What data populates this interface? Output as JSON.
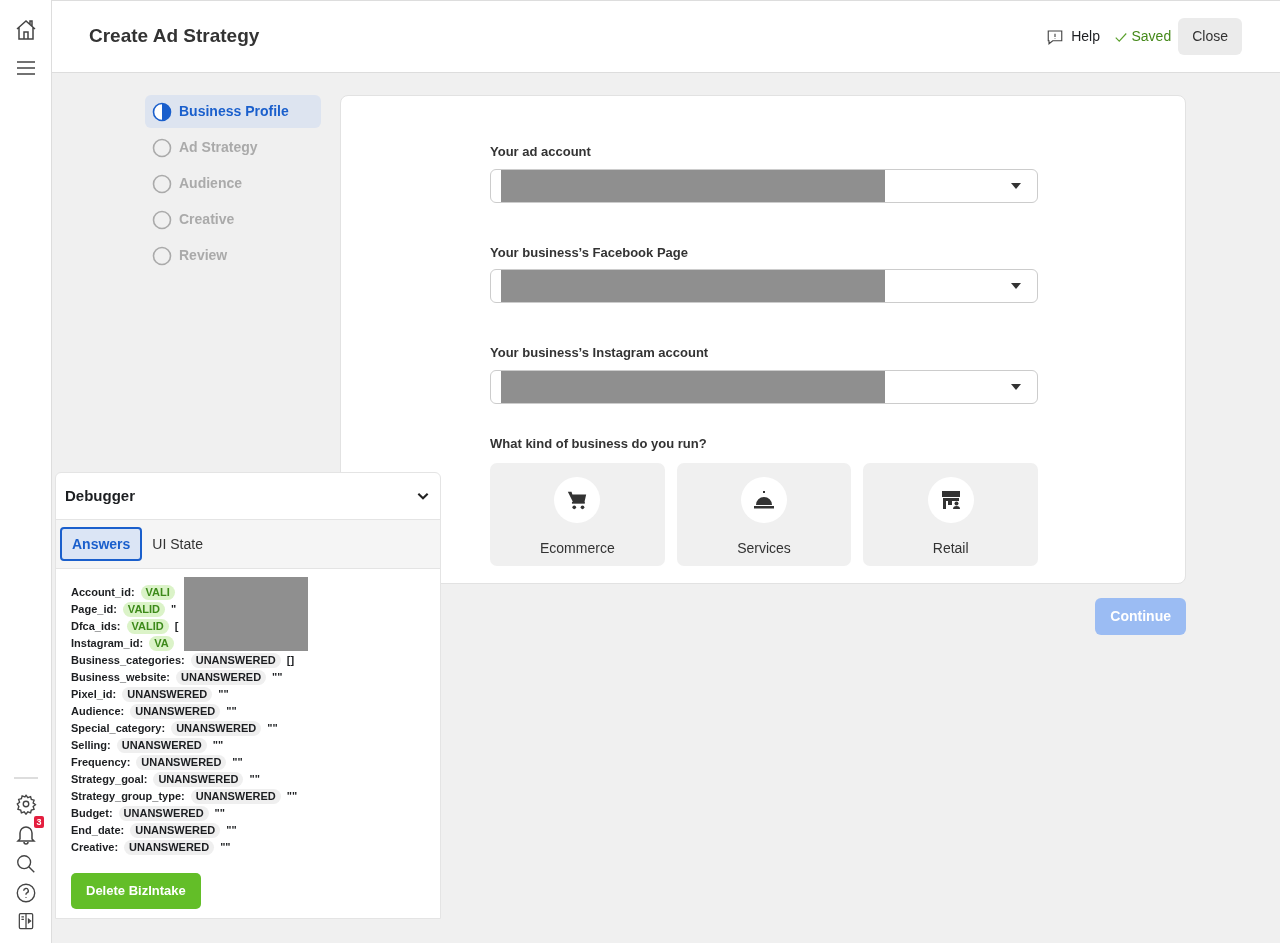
{
  "sidebar": {
    "notification_count": "3"
  },
  "header": {
    "title": "Create Ad Strategy",
    "help": "Help",
    "saved": "Saved",
    "close": "Close"
  },
  "steps": [
    {
      "label": "Business Profile",
      "selected": true
    },
    {
      "label": "Ad Strategy",
      "selected": false
    },
    {
      "label": "Audience",
      "selected": false
    },
    {
      "label": "Creative",
      "selected": false
    },
    {
      "label": "Review",
      "selected": false
    }
  ],
  "form": {
    "fields": [
      {
        "label": "Your ad account",
        "redacted": true
      },
      {
        "label": "Your business’s Facebook Page",
        "redacted": true
      },
      {
        "label": "Your business’s Instagram account",
        "redacted": true
      }
    ],
    "business_question": "What kind of business do you run?",
    "business_types": [
      {
        "label": "Ecommerce",
        "kind": "cart"
      },
      {
        "label": "Services",
        "kind": "bell"
      },
      {
        "label": "Retail",
        "kind": "store"
      }
    ]
  },
  "continue_button": {
    "label": "Continue",
    "disabled": true
  },
  "debugger": {
    "title": "Debugger",
    "redacted": true,
    "tabs": [
      {
        "label": "Answers",
        "selected": true
      },
      {
        "label": "UI State",
        "selected": false
      }
    ],
    "answers": [
      {
        "key": "Account_id:",
        "status": "VALI",
        "kind": "valid"
      },
      {
        "key": "Page_id:",
        "status": "VALID",
        "kind": "valid",
        "value": "\""
      },
      {
        "key": "Dfca_ids:",
        "status": "VALID",
        "kind": "valid",
        "value": "["
      },
      {
        "key": "Instagram_id:",
        "status": "VA",
        "kind": "valid"
      },
      {
        "key": "Business_categories:",
        "status": "UNANSWERED",
        "kind": "unanswered",
        "value": "[]"
      },
      {
        "key": "Business_website:",
        "status": "UNANSWERED",
        "kind": "unanswered",
        "value": "\"\""
      },
      {
        "key": "Pixel_id:",
        "status": "UNANSWERED",
        "kind": "unanswered",
        "value": "\"\""
      },
      {
        "key": "Audience:",
        "status": "UNANSWERED",
        "kind": "unanswered",
        "value": "\"\""
      },
      {
        "key": "Special_category:",
        "status": "UNANSWERED",
        "kind": "unanswered",
        "value": "\"\""
      },
      {
        "key": "Selling:",
        "status": "UNANSWERED",
        "kind": "unanswered",
        "value": "\"\""
      },
      {
        "key": "Frequency:",
        "status": "UNANSWERED",
        "kind": "unanswered",
        "value": "\"\""
      },
      {
        "key": "Strategy_goal:",
        "status": "UNANSWERED",
        "kind": "unanswered",
        "value": "\"\""
      },
      {
        "key": "Strategy_group_type:",
        "status": "UNANSWERED",
        "kind": "unanswered",
        "value": "\"\""
      },
      {
        "key": "Budget:",
        "status": "UNANSWERED",
        "kind": "unanswered",
        "value": "\"\""
      },
      {
        "key": "End_date:",
        "status": "UNANSWERED",
        "kind": "unanswered",
        "value": "\"\""
      },
      {
        "key": "Creative:",
        "status": "UNANSWERED",
        "kind": "unanswered",
        "value": "\"\""
      }
    ],
    "delete_button": "Delete BizIntake"
  }
}
